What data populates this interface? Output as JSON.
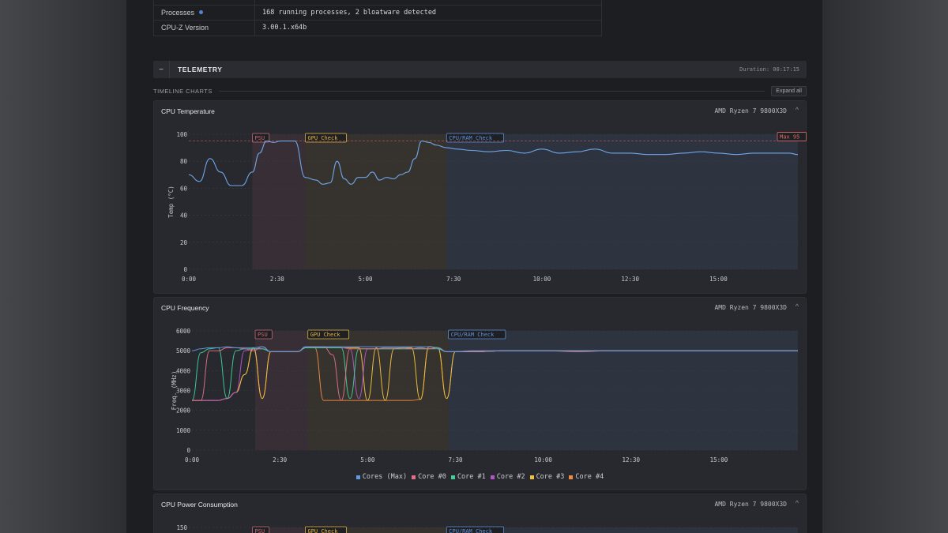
{
  "info": {
    "rows": [
      {
        "label": "Processes",
        "value": "168 running processes, 2 bloatware detected",
        "dot": true
      },
      {
        "label": "CPU-Z Version",
        "value": "3.00.1.x64b",
        "dot": false
      }
    ]
  },
  "telemetry": {
    "collapse_label": "−",
    "title": "TELEMETRY",
    "duration": "Duration: 00:17:15",
    "section_label": "TIMELINE CHARTS",
    "expand_label": "Expand all"
  },
  "colors": {
    "accent": "#4d86d6",
    "psu": "#c76a73",
    "gpu": "#e0b23e",
    "cpuram": "#5f8fd8",
    "max": "#e06a6a"
  },
  "charts": [
    {
      "id": "temp",
      "title": "CPU Temperature",
      "cpu": "AMD Ryzen 7 9800X3D",
      "chevron": "^",
      "ylabel": "Temp (°C)",
      "ylim": [
        0,
        100
      ],
      "yticks": [
        "0",
        "20",
        "40",
        "60",
        "80",
        "100"
      ],
      "xtick_labels": [
        "0:00",
        "2:30",
        "5:00",
        "7:30",
        "10:00",
        "12:30",
        "15:00"
      ],
      "regions": [
        {
          "label": "PSU",
          "key": "psu"
        },
        {
          "label": "GPU Check",
          "key": "gpu"
        },
        {
          "label": "CPU/RAM Check",
          "key": "cpuram"
        }
      ],
      "max_label": "Max 95"
    },
    {
      "id": "freq",
      "title": "CPU Frequency",
      "cpu": "AMD Ryzen 7 9800X3D",
      "chevron": "^",
      "ylabel": "Freq. (MHz)",
      "ylim": [
        0,
        6000
      ],
      "yticks": [
        "0",
        "1000",
        "2000",
        "3000",
        "4000",
        "5000",
        "6000"
      ],
      "xtick_labels": [
        "0:00",
        "2:30",
        "5:00",
        "7:30",
        "10:00",
        "12:30",
        "15:00"
      ],
      "regions": [
        {
          "label": "PSU",
          "key": "psu"
        },
        {
          "label": "GPU Check",
          "key": "gpu"
        },
        {
          "label": "CPU/RAM Check",
          "key": "cpuram"
        }
      ],
      "legend": [
        {
          "label": "Cores (Max)",
          "color": "#5f9be0"
        },
        {
          "label": "Core #0",
          "color": "#e07085"
        },
        {
          "label": "Core #1",
          "color": "#3ecf9a"
        },
        {
          "label": "Core #2",
          "color": "#b455c7"
        },
        {
          "label": "Core #3",
          "color": "#f0c23c"
        },
        {
          "label": "Core #4",
          "color": "#ee8a42"
        }
      ]
    },
    {
      "id": "power",
      "title": "CPU Power Consumption",
      "cpu": "AMD Ryzen 7 9800X3D",
      "chevron": "^",
      "ytick_top": "150",
      "regions": [
        {
          "label": "PSU",
          "key": "psu"
        },
        {
          "label": "GPU Check",
          "key": "gpu"
        },
        {
          "label": "CPU/RAM Check",
          "key": "cpuram"
        }
      ]
    }
  ],
  "chart_data": [
    {
      "type": "line",
      "title": "CPU Temperature",
      "xlabel": "",
      "ylabel": "Temp (°C)",
      "ylim": [
        0,
        100
      ],
      "x_range_min": [
        0,
        17.25
      ],
      "grid": true,
      "reference_line": {
        "label": "Max 95",
        "value": 95
      },
      "series": [
        {
          "x": [
            0,
            0.3,
            0.6,
            0.9,
            1.2,
            1.5,
            1.8,
            2.0,
            2.2,
            2.4,
            2.6,
            2.8,
            3.0,
            3.3,
            3.6,
            3.8,
            4.0,
            4.2,
            4.4,
            4.6,
            4.8,
            5.0,
            5.2,
            5.4,
            5.6,
            5.8,
            6.0,
            6.2,
            6.4,
            6.6,
            6.8,
            7.0,
            7.3,
            7.6,
            8.0,
            8.5,
            9.0,
            9.5,
            10.0,
            10.5,
            11.0,
            11.5,
            12.0,
            12.5,
            13.0,
            13.5,
            14.0,
            14.5,
            15.0,
            15.5,
            16.0,
            16.5,
            17.0,
            17.25
          ],
          "values": [
            70,
            65,
            82,
            72,
            62,
            62,
            72,
            86,
            95,
            94,
            95,
            95,
            95,
            68,
            66,
            63,
            64,
            80,
            67,
            63,
            68,
            68,
            72,
            66,
            68,
            67,
            70,
            72,
            82,
            95,
            94,
            92,
            90,
            89,
            88,
            87,
            88,
            86,
            89,
            86,
            87,
            89,
            86,
            86,
            85,
            85,
            86,
            87,
            86,
            85,
            86,
            86,
            86,
            85
          ]
        }
      ]
    },
    {
      "type": "line",
      "title": "CPU Frequency",
      "xlabel": "",
      "ylabel": "Freq. (MHz)",
      "ylim": [
        0,
        6000
      ],
      "x_range_min": [
        0,
        17.25
      ],
      "grid": true,
      "legend": "bottom",
      "x": [
        0,
        0.25,
        0.5,
        0.75,
        1.0,
        1.25,
        1.5,
        1.75,
        2.0,
        2.25,
        2.5,
        2.75,
        3.0,
        3.25,
        3.5,
        3.75,
        4.0,
        4.25,
        4.5,
        4.75,
        5.0,
        5.25,
        5.5,
        5.75,
        6.0,
        6.25,
        6.5,
        6.75,
        7.0,
        7.25,
        7.5,
        8.0,
        9.0,
        10.0,
        11.0,
        12.0,
        13.0,
        14.0,
        15.0,
        16.0,
        17.25
      ],
      "series": [
        {
          "name": "Cores (Max)",
          "values": [
            5000,
            5100,
            5150,
            5150,
            5200,
            5150,
            5150,
            5150,
            5200,
            4950,
            4950,
            4950,
            4950,
            5200,
            5200,
            5200,
            5200,
            5200,
            5200,
            5200,
            5200,
            5200,
            5200,
            5200,
            5200,
            5200,
            5200,
            5200,
            5150,
            4950,
            4950,
            5000,
            5000,
            5000,
            5000,
            5000,
            5000,
            5000,
            5000,
            5000,
            5000
          ]
        },
        {
          "name": "Core #0",
          "values": [
            2500,
            2500,
            5000,
            5000,
            5150,
            5150,
            5100,
            5000,
            5200,
            4950,
            4950,
            4950,
            4950,
            5200,
            5200,
            5200,
            4800,
            2500,
            5100,
            5100,
            5100,
            5100,
            5150,
            5150,
            5150,
            5100,
            5150,
            5100,
            5150,
            4950,
            4950,
            4950,
            5000,
            5000,
            4950,
            5000,
            5000,
            5000,
            5000,
            5000,
            5000
          ]
        },
        {
          "name": "Core #1",
          "values": [
            2500,
            4900,
            5100,
            5150,
            2600,
            5000,
            5100,
            5100,
            5100,
            4950,
            4950,
            4950,
            4950,
            5150,
            5150,
            5150,
            5150,
            5150,
            2600,
            5100,
            5100,
            5100,
            5100,
            5100,
            5100,
            5100,
            5100,
            5100,
            5100,
            4950,
            4950,
            4950,
            5000,
            5000,
            5000,
            5000,
            5000,
            5000,
            5000,
            5000,
            5000
          ]
        },
        {
          "name": "Core #2",
          "values": [
            2500,
            2500,
            2500,
            2500,
            2600,
            2900,
            5000,
            5100,
            5100,
            4950,
            4950,
            4950,
            4950,
            5150,
            5150,
            5150,
            5150,
            5150,
            5100,
            2600,
            5100,
            5100,
            5100,
            5100,
            5100,
            5100,
            5100,
            5100,
            5150,
            4950,
            4950,
            5000,
            5000,
            5000,
            5000,
            5000,
            5000,
            5000,
            5000,
            5000,
            5000
          ]
        },
        {
          "name": "Core #3",
          "values": [
            2500,
            2500,
            2500,
            2500,
            2600,
            2900,
            3800,
            5150,
            2600,
            4950,
            4950,
            4950,
            4950,
            5150,
            5150,
            5150,
            5150,
            5150,
            5150,
            5150,
            2500,
            5150,
            2500,
            5100,
            5150,
            5150,
            2550,
            5200,
            5150,
            2600,
            4950,
            4950,
            5000,
            5000,
            5000,
            5000,
            5000,
            5000,
            5000,
            5000,
            5000
          ]
        },
        {
          "name": "Core #4",
          "values": [
            2500,
            2500,
            2500,
            2500,
            2600,
            2900,
            3800,
            5100,
            2600,
            4950,
            4950,
            4950,
            4950,
            5150,
            5150,
            2500,
            2500,
            2500,
            2500,
            2500,
            2500,
            2500,
            2500,
            2500,
            2500,
            2500,
            2550,
            5200,
            5150,
            2600,
            4950,
            4950,
            5000,
            5000,
            5000,
            5000,
            5000,
            5000,
            5000,
            5000,
            5000
          ]
        }
      ]
    }
  ]
}
